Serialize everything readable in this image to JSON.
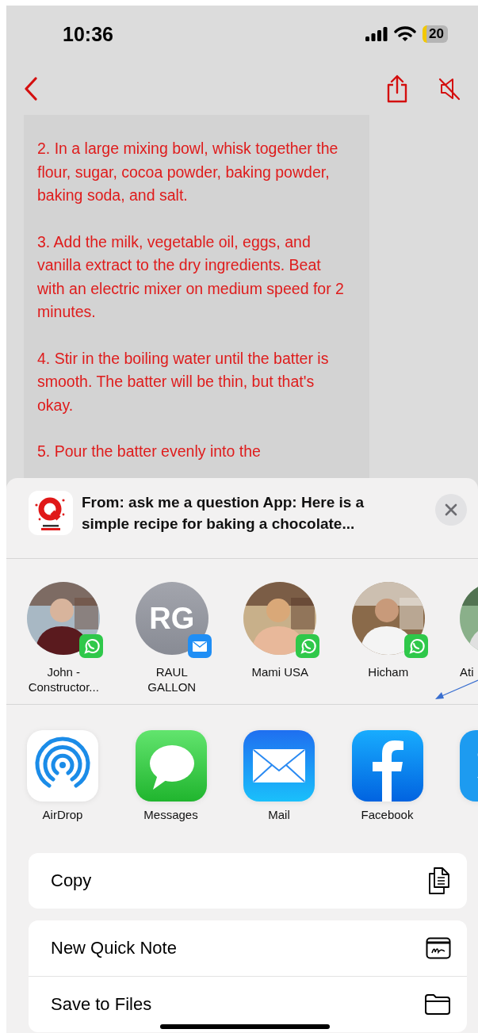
{
  "status_bar": {
    "time": "10:36",
    "battery": "20"
  },
  "recipe": {
    "paragraphs": [
      "2. In a large mixing bowl, whisk together the flour, sugar, cocoa powder, baking powder, baking soda, and salt.",
      "3. Add the milk, vegetable oil, eggs, and vanilla extract to the dry ingredients. Beat with an electric mixer on medium speed for 2 minutes.",
      "4. Stir in the boiling water until the batter is smooth. The batter will be thin, but that's okay.",
      "5. Pour the batter evenly into the"
    ]
  },
  "share_sheet": {
    "title": "From: ask me a question App: Here is a simple recipe for baking a chocolate...",
    "contacts": [
      {
        "name": "John -\nConstructor...",
        "kind": "picture",
        "badge": {
          "kind": "whatsapp"
        }
      },
      {
        "name": "RAUL\nGALLON",
        "kind": "initials",
        "initials": "RG",
        "badge": {
          "kind": "mail"
        }
      },
      {
        "name": "Mami USA",
        "kind": "picture",
        "badge": {
          "kind": "whatsapp"
        }
      },
      {
        "name": "Hicham",
        "kind": "picture",
        "badge": {
          "kind": "whatsapp"
        }
      },
      {
        "name": "Ati",
        "kind": "picture"
      }
    ],
    "apps": [
      {
        "label": "AirDrop",
        "kind": "airdrop"
      },
      {
        "label": "Messages",
        "kind": "messages"
      },
      {
        "label": "Mail",
        "kind": "mail"
      },
      {
        "label": "Facebook",
        "kind": "facebook"
      },
      {
        "kind": "twitter"
      }
    ],
    "action_groups": [
      [
        {
          "label": "Copy",
          "kind": "copy"
        }
      ],
      [
        {
          "label": "New Quick Note",
          "kind": "quicknote"
        },
        {
          "label": "Save to Files",
          "kind": "files"
        }
      ]
    ]
  }
}
